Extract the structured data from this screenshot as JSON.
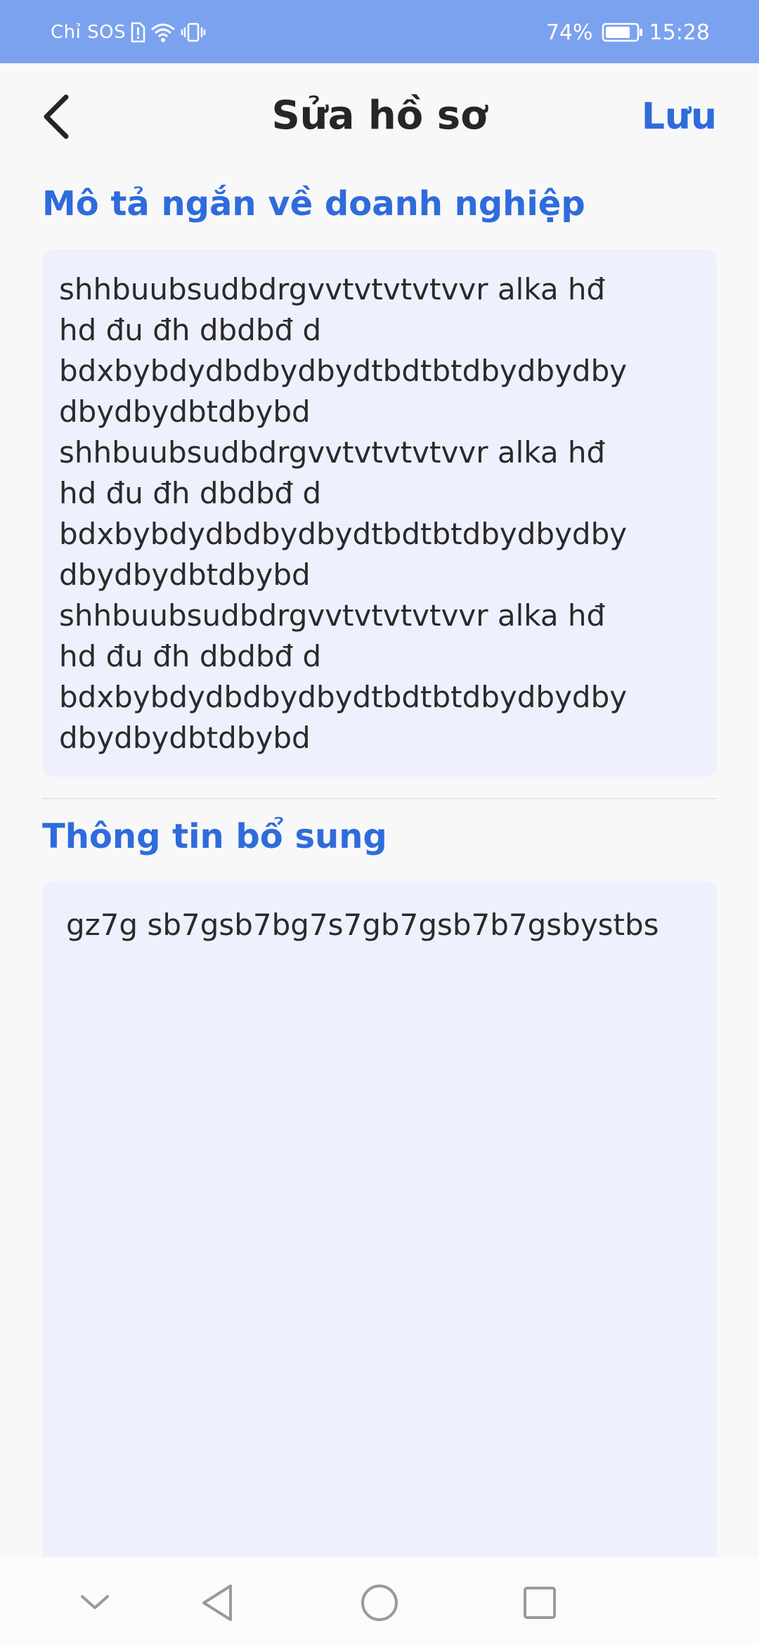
{
  "status_bar": {
    "carrier": "Chỉ SOS",
    "battery_percent": "74%",
    "time": "15:28"
  },
  "header": {
    "title": "Sửa hồ sơ",
    "save_label": "Lưu"
  },
  "description_section": {
    "title": "Mô tả ngắn về doanh nghiệp",
    "lines": [
      "shhbuubsudbdrgvvtvtvtvtvvr alka hđ",
      "hd đu đh dbdbđ d",
      "bdxbybdydbdbydbydtbdtbtdbydbydby",
      "dbydbydbtdbybd",
      "shhbuubsudbdrgvvtvtvtvtvvr alka hđ",
      "hd đu đh dbdbđ d",
      "bdxbybdydbdbydbydtbdtbtdbydbydby",
      "dbydbydbtdbybd",
      "shhbuubsudbdrgvvtvtvtvtvvr alka hđ",
      "hd đu đh dbdbđ d",
      "bdxbybdydbdbydbydtbdtbtdbydbydby",
      "dbydbydbtdbybd"
    ]
  },
  "additional_section": {
    "title": "Thông tin bổ sung",
    "value": "gz7g sb7gsb7bg7s7gb7gsb7b7gsbystbs"
  },
  "icons": {
    "back": "chevron-left-icon",
    "nav_hide": "chevron-down-icon",
    "nav_back": "triangle-back-icon",
    "nav_home": "circle-home-icon",
    "nav_recent": "square-recent-icon"
  },
  "colors": {
    "status_bar": "#7ba2ee",
    "accent": "#2f6bdc",
    "text_box_bg": "#eef1fd"
  }
}
